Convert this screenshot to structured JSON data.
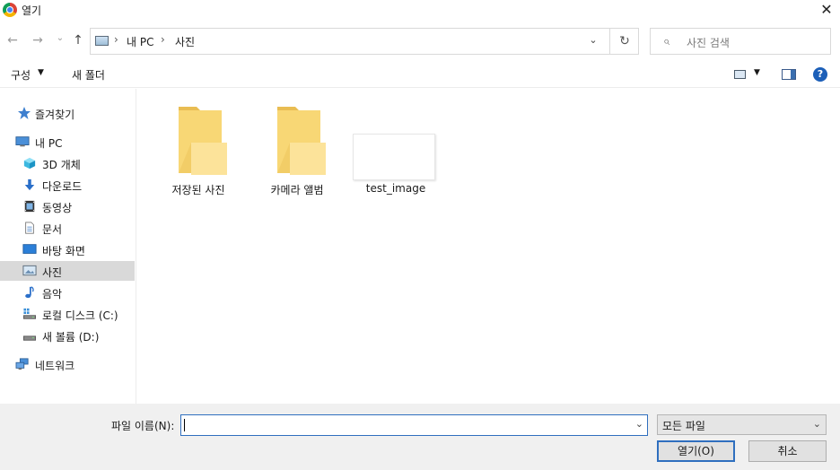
{
  "window": {
    "title": "열기",
    "close_glyph": "✕"
  },
  "nav": {
    "back_glyph": "←",
    "forward_glyph": "→",
    "recent_glyph": "⌄",
    "up_glyph": "↑",
    "breadcrumb": [
      "내 PC",
      "사진"
    ],
    "sep_glyph": "›",
    "dropdown_glyph": "⌄",
    "refresh_glyph": "↻",
    "search_placeholder": "사진 검색",
    "search_glyph": "⌕"
  },
  "toolbar": {
    "organize_label": "구성",
    "caret_glyph": "▼",
    "new_folder_label": "새 폴더",
    "help_glyph": "?"
  },
  "sidebar": {
    "items": [
      {
        "label": "즐겨찾기",
        "icon": "star-icon"
      },
      {
        "label": "내 PC",
        "icon": "computer-icon"
      },
      {
        "label": "3D 개체",
        "icon": "cube-icon"
      },
      {
        "label": "다운로드",
        "icon": "download-icon"
      },
      {
        "label": "동영상",
        "icon": "video-icon"
      },
      {
        "label": "문서",
        "icon": "document-icon"
      },
      {
        "label": "바탕 화면",
        "icon": "desktop-icon"
      },
      {
        "label": "사진",
        "icon": "pictures-icon",
        "selected": true
      },
      {
        "label": "음악",
        "icon": "music-icon"
      },
      {
        "label": "로컬 디스크 (C:)",
        "icon": "drive-c-icon"
      },
      {
        "label": "새 볼륨 (D:)",
        "icon": "drive-d-icon"
      },
      {
        "label": "네트워크",
        "icon": "network-icon"
      }
    ]
  },
  "content": {
    "items": [
      {
        "label": "저장된 사진",
        "type": "folder",
        "icon": "folder-icon"
      },
      {
        "label": "카메라 앨범",
        "type": "folder",
        "icon": "folder-icon"
      },
      {
        "label": "test_image",
        "type": "image",
        "icon": "image-thumbnail"
      }
    ]
  },
  "footer": {
    "filename_label": "파일 이름(N):",
    "filename_value": "",
    "filetype_value": "모든 파일",
    "dropdown_glyph": "⌄",
    "open_label": "열기(O)",
    "cancel_label": "취소"
  },
  "colors": {
    "accent": "#2f6fbf",
    "folder": "#f8d775",
    "selected": "#d9d9d9"
  }
}
